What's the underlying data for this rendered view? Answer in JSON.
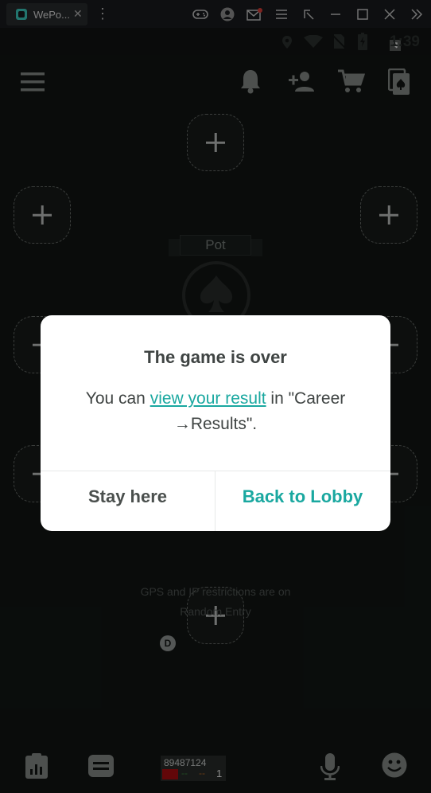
{
  "emulator": {
    "tab_title": "WePo...",
    "tab_close": "✕",
    "icons": [
      "gamepad-icon",
      "account-icon",
      "mail-icon",
      "menu-icon",
      "resize-icon",
      "minimize-icon",
      "maximize-icon",
      "close-icon",
      "collapse-icon"
    ]
  },
  "status_bar": {
    "time": "1:39"
  },
  "table": {
    "pot_label": "Pot",
    "gps_text": "GPS and IP restrictions are on",
    "entry_text": "Random Entry",
    "dealer_badge": "D",
    "player": {
      "id": "89487124",
      "dash1": "--",
      "dash2": "--",
      "count": "1",
      "color": "#b30d12"
    }
  },
  "dialog": {
    "title": "The game is over",
    "msg_prefix": "You can ",
    "msg_link": "view your result",
    "msg_suffix": " in \"Career →Results\".",
    "stay_label": "Stay here",
    "lobby_label": "Back to Lobby",
    "accent": "#1aa8a0"
  }
}
